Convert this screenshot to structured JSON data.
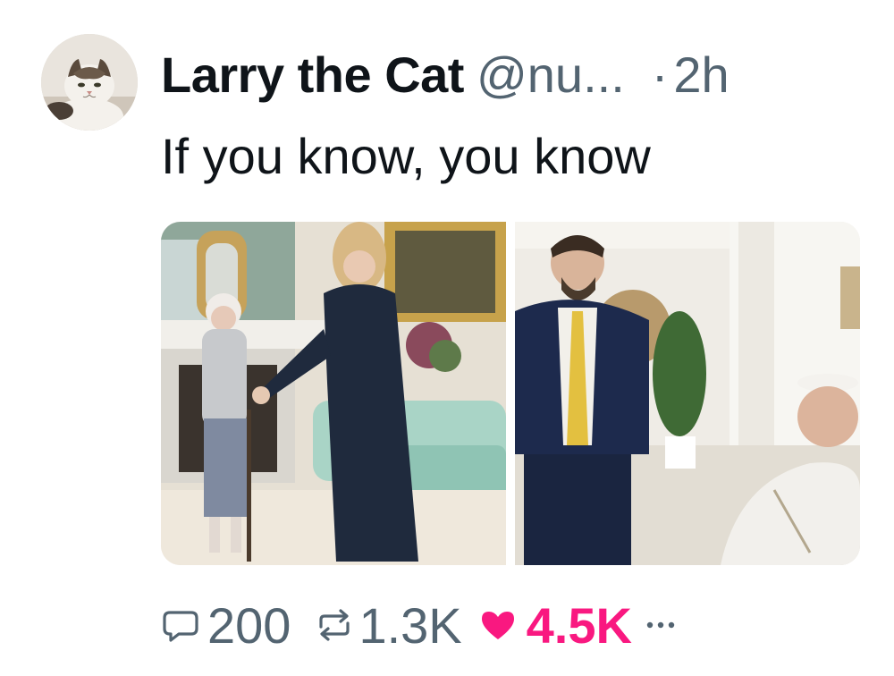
{
  "author": {
    "display_name": "Larry the Cat",
    "handle": "@nu...",
    "separator": "·",
    "time": "2h"
  },
  "tweet": {
    "text": "If you know, you know"
  },
  "media": {
    "photos": [
      {
        "icon": "photo-meeting-drawing-room"
      },
      {
        "icon": "photo-meeting-white-room"
      }
    ]
  },
  "metrics": {
    "replies": "200",
    "retweets": "1.3K",
    "likes": "4.5K"
  },
  "colors": {
    "text": "#0f1419",
    "secondary": "#536471",
    "like": "#f91880"
  }
}
